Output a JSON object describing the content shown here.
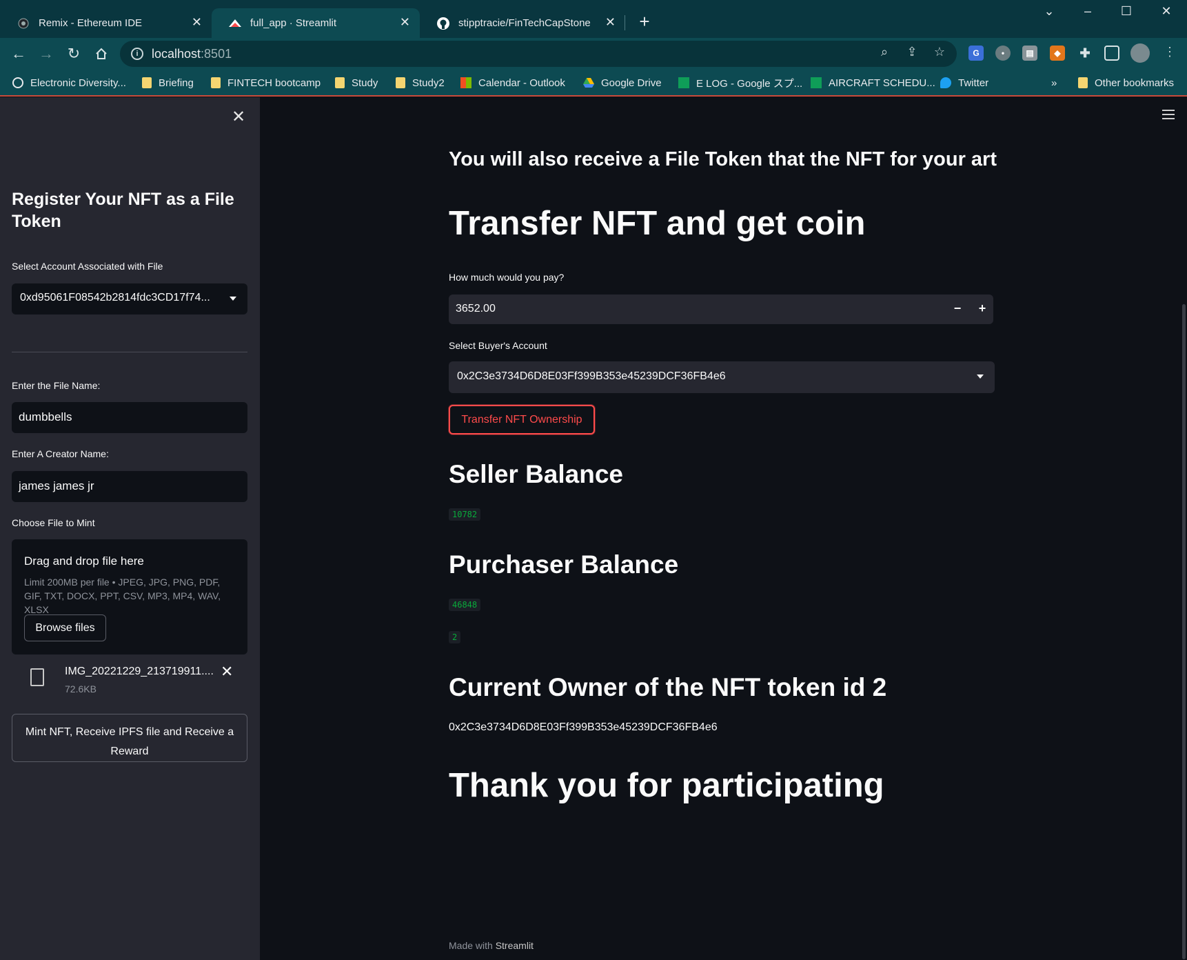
{
  "tabs": [
    {
      "title": "Remix - Ethereum IDE",
      "icon": "remix-icon"
    },
    {
      "title": "full_app · Streamlit",
      "icon": "streamlit-icon",
      "active": true
    },
    {
      "title": "stipptracie/FinTechCapStone",
      "icon": "github-icon"
    }
  ],
  "address_bar": {
    "host": "localhost",
    "port": ":8501"
  },
  "bookmarks": [
    {
      "label": "Electronic Diversity...",
      "icon": "globe-icon"
    },
    {
      "label": "Briefing",
      "icon": "folder-icon"
    },
    {
      "label": "FINTECH bootcamp",
      "icon": "folder-icon"
    },
    {
      "label": "Study",
      "icon": "folder-icon"
    },
    {
      "label": "Study2",
      "icon": "folder-icon"
    },
    {
      "label": "Calendar - Outlook",
      "icon": "outlook-icon"
    },
    {
      "label": "Google Drive",
      "icon": "drive-icon"
    },
    {
      "label": "E LOG - Google スプ...",
      "icon": "sheets-icon"
    },
    {
      "label": "AIRCRAFT SCHEDU...",
      "icon": "sheets-icon"
    },
    {
      "label": "Twitter",
      "icon": "twitter-icon"
    }
  ],
  "bookmarks_overflow": "»",
  "other_bookmarks": "Other bookmarks",
  "sidebar": {
    "title": "Register Your NFT as a File Token",
    "account_label": "Select Account Associated with File",
    "account_value": "0xd95061F08542b2814fdc3CD17f74...",
    "file_name_label": "Enter the File Name:",
    "file_name_value": "dumbbells",
    "creator_label": "Enter A Creator Name:",
    "creator_value": "james james jr",
    "choose_file_label": "Choose File to Mint",
    "dropzone_title": "Drag and drop file here",
    "dropzone_limit": "Limit 200MB per file • JPEG, JPG, PNG, PDF, GIF, TXT, DOCX, PPT, CSV, MP3, MP4, WAV, XLSX",
    "browse_label": "Browse files",
    "uploaded_file_name": "IMG_20221229_213719911....",
    "uploaded_file_size": "72.6KB",
    "mint_button": "Mint NFT, Receive IPFS file and Receive a Reward"
  },
  "main": {
    "subheading": "You will also receive a File Token that the NFT for your art",
    "transfer_title": "Transfer NFT and get coin",
    "pay_label": "How much would you pay?",
    "pay_value": "3652.00",
    "buyer_label": "Select Buyer's Account",
    "buyer_value": "0x2C3e3734D6D8E03Ff399B353e45239DCF36FB4e6",
    "transfer_button": "Transfer NFT Ownership",
    "seller_title": "Seller Balance",
    "seller_balance": "10782",
    "purchaser_title": "Purchaser Balance",
    "purchaser_balance": "46848",
    "token_count": "2",
    "owner_title": "Current Owner of the NFT token id 2",
    "owner_address": "0x2C3e3734D6D8E03Ff399B353e45239DCF36FB4e6",
    "thanks": "Thank you for participating",
    "footer_prefix": "Made with",
    "footer_brand": "Streamlit"
  },
  "colors": {
    "primary_red": "#ff4b4b",
    "code_green": "#09ab3b",
    "app_bg": "#0e1117",
    "sidebar_bg": "#262730",
    "chrome_teal": "#0d4a52"
  }
}
